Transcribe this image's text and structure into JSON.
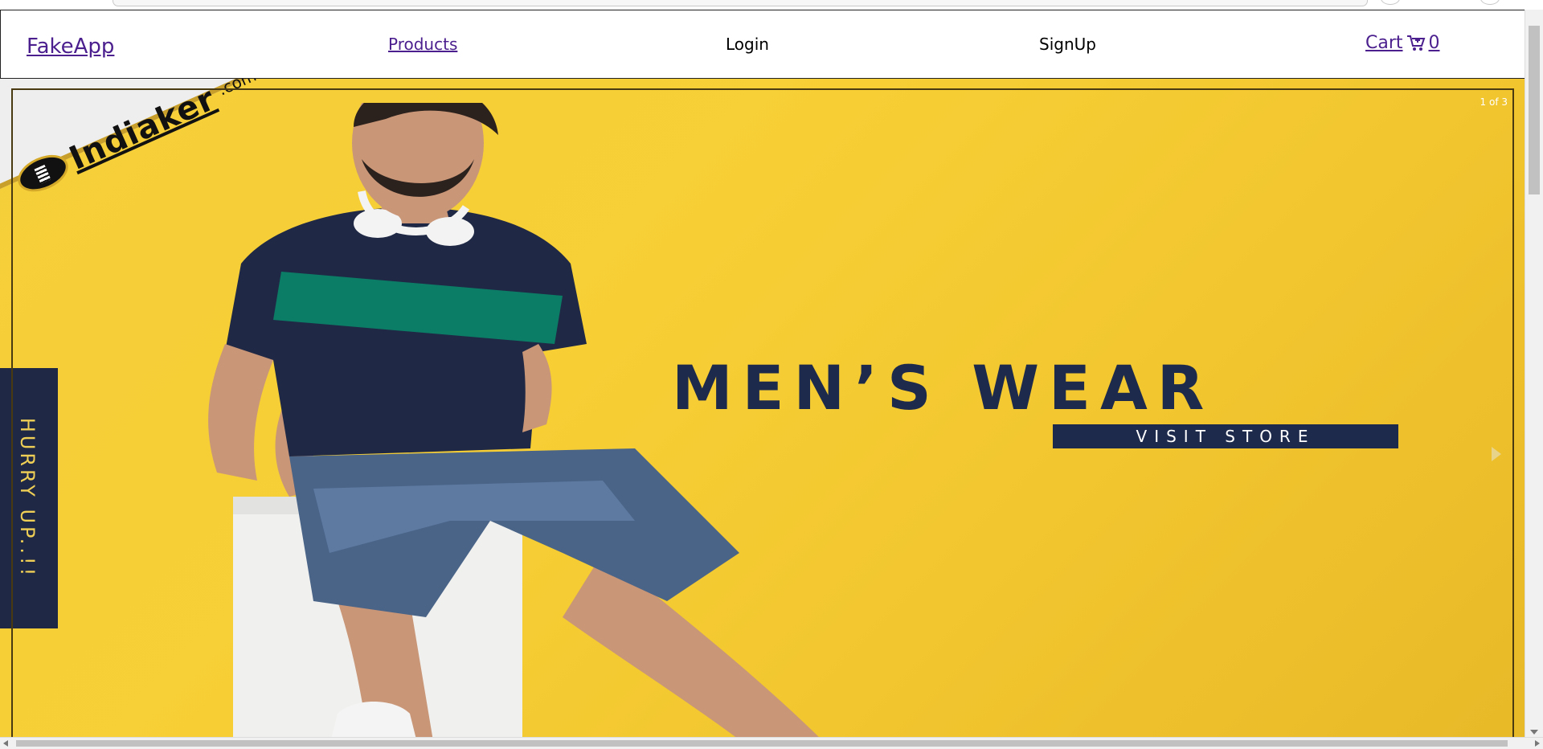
{
  "navbar": {
    "brand": "FakeApp",
    "products": "Products",
    "login": "Login",
    "signup": "SignUp",
    "cart_label": "Cart",
    "cart_count": "0"
  },
  "carousel": {
    "counter": "1 of 3",
    "logo_word": "Indiaker",
    "logo_domain": ".com",
    "side_tab": "HURRY UP..!!",
    "headline": "MEN’S WEAR",
    "cta": "VISIT STORE"
  },
  "icons": {
    "cart": "cart-icon",
    "next": "chevron-right-icon"
  },
  "colors": {
    "link": "#4b1f8e",
    "banner_yellow": "#f5cf3a",
    "navy": "#1e2a4c",
    "hurry_text": "#efcf55"
  }
}
